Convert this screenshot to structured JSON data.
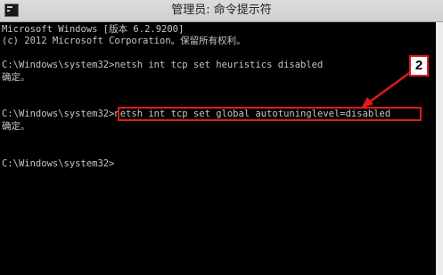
{
  "window": {
    "title": "管理员: 命令提示符"
  },
  "console": {
    "lines": [
      "Microsoft Windows [版本 6.2.9200]",
      "(c) 2012 Microsoft Corporation。保留所有权利。",
      "",
      "C:\\Windows\\system32>netsh int tcp set heuristics disabled",
      "确定。",
      "",
      "",
      "C:\\Windows\\system32>netsh int tcp set global autotuninglevel=disabled",
      "确定。",
      "",
      "",
      "C:\\Windows\\system32>"
    ]
  },
  "annotation": {
    "step_label": "2",
    "color": "#e01b1b"
  }
}
